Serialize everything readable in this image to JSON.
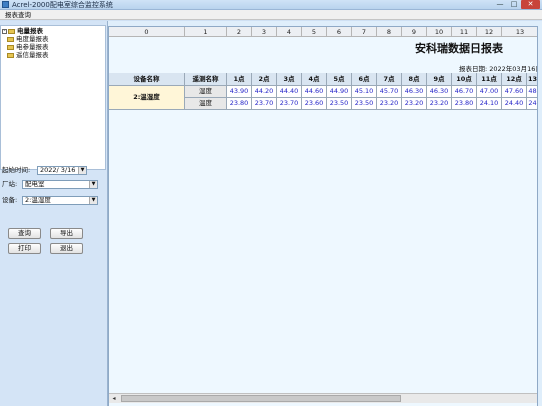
{
  "window": {
    "title": "Acrel-2000配电室综合监控系统",
    "min_glyph": "—",
    "max_glyph": "□",
    "close_glyph": "✕"
  },
  "menu": {
    "item": "报表查询"
  },
  "tree": {
    "root": "电量报表",
    "children": [
      "电度量报表",
      "电参量报表",
      "遥信量报表"
    ]
  },
  "form": {
    "start_time_label": "起始时间:",
    "start_time_value": "2022/ 3/16",
    "station_label": "厂站:",
    "station_value": "配电室",
    "device_label": "设备:",
    "device_value": "2:温湿度"
  },
  "buttons": {
    "query": "查询",
    "export": "导出",
    "print": "打印",
    "exit": "退出"
  },
  "grid": {
    "column_numbers": [
      "0",
      "1",
      "2",
      "3",
      "4",
      "5",
      "6",
      "7",
      "8",
      "9",
      "10",
      "11",
      "12",
      "13"
    ]
  },
  "report": {
    "title": "安科瑞数据日报表",
    "date_label": "报表日期: 2022年03月16日",
    "headers": [
      "设备名称",
      "遥测名称",
      "1点",
      "2点",
      "3点",
      "4点",
      "5点",
      "6点",
      "7点",
      "8点",
      "9点",
      "10点",
      "11点",
      "12点",
      "13"
    ],
    "device_name": "2:温湿度",
    "rows": [
      {
        "name": "湿度",
        "values": [
          "43.90",
          "44.20",
          "44.40",
          "44.60",
          "44.90",
          "45.10",
          "45.70",
          "46.30",
          "46.30",
          "46.70",
          "47.00",
          "47.60",
          "48"
        ]
      },
      {
        "name": "温度",
        "values": [
          "23.80",
          "23.70",
          "23.70",
          "23.60",
          "23.50",
          "23.50",
          "23.20",
          "23.20",
          "23.20",
          "23.80",
          "24.10",
          "24.40",
          "24"
        ]
      }
    ]
  },
  "scrollbar": {
    "left_arrow": "◂"
  }
}
